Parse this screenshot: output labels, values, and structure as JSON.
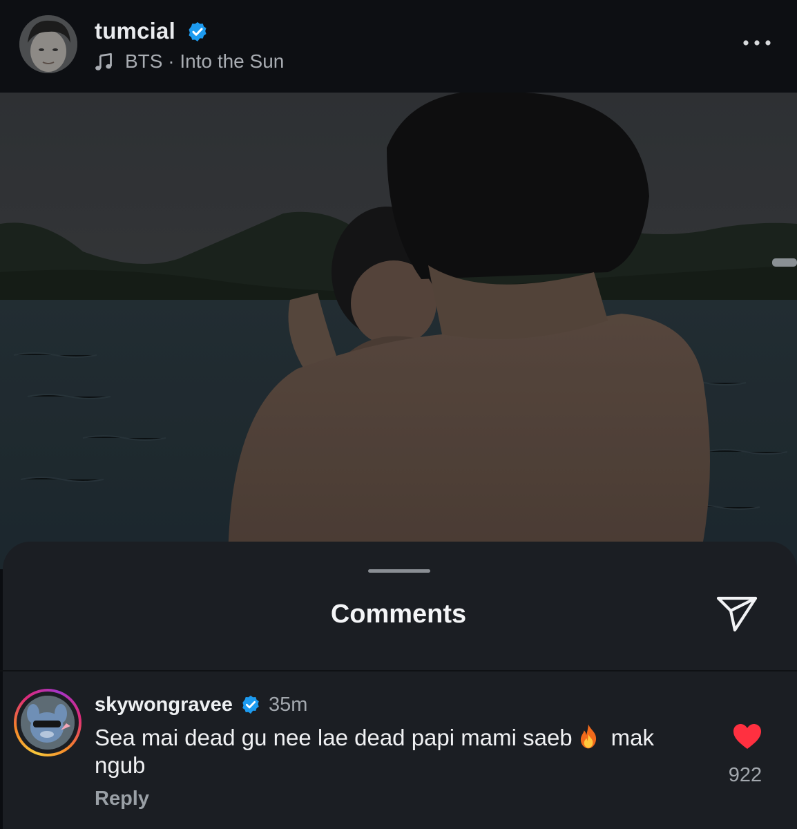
{
  "post": {
    "username": "tumcial",
    "verified": true,
    "song": "BTS · Into the Sun",
    "more_icon": "more-horizontal-icon",
    "music_icon": "music-note-icon"
  },
  "comments_sheet": {
    "title": "Comments",
    "share_icon": "send-icon",
    "comments": [
      {
        "username": "skywongravee",
        "verified": true,
        "time": "35m",
        "text_before_emoji": "Sea mai dead gu nee lae dead papi mami saeb",
        "emoji": "fire-emoji",
        "text_after_emoji": "mak ngub",
        "reply_label": "Reply",
        "likes": "922",
        "liked": true
      }
    ]
  },
  "colors": {
    "verified_badge": "#1d9bf0",
    "like_heart": "#ff3040",
    "sheet_background": "#1b1e23",
    "header_background": "#0d0f13"
  }
}
